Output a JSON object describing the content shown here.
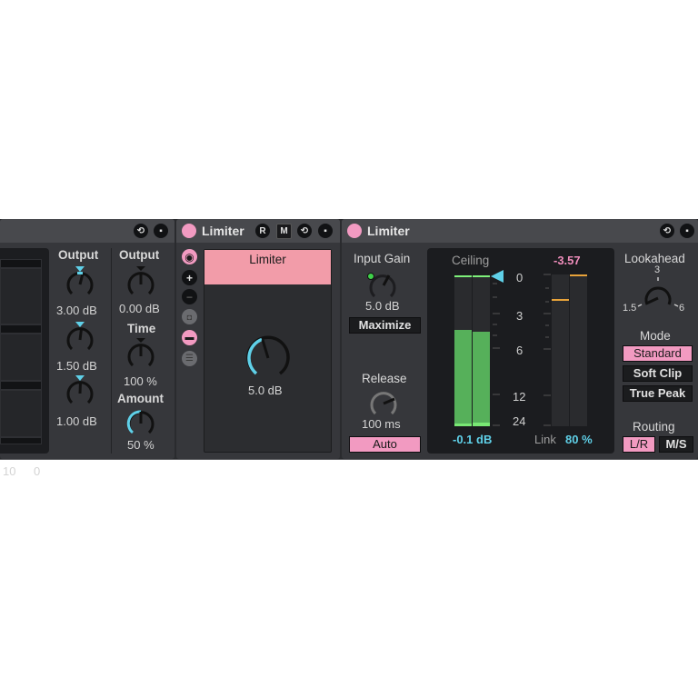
{
  "device1": {
    "output_label": "Output",
    "band_outputs": [
      "3.00 dB",
      "1.50 dB",
      "1.00 dB"
    ],
    "output2_label": "Output",
    "output2_value": "0.00 dB",
    "time_label": "Time",
    "time_value": "100 %",
    "amount_label": "Amount",
    "amount_value": "50 %",
    "scale_labels": [
      "10",
      "0"
    ],
    "icons": [
      "hot-swap-icon",
      "save-icon"
    ]
  },
  "device2": {
    "title": "Limiter",
    "r_label": "R",
    "m_label": "M",
    "macro_name": "Limiter",
    "macro_value": "5.0 dB",
    "icons": [
      "hot-swap-icon",
      "save-icon"
    ]
  },
  "device3": {
    "title": "Limiter",
    "input_gain_label": "Input Gain",
    "input_gain_value": "5.0 dB",
    "maximize_label": "Maximize",
    "release_label": "Release",
    "release_value": "100 ms",
    "auto_label": "Auto",
    "ceiling_label": "Ceiling",
    "ceiling_value": "-0.1 dB",
    "meter_scale": [
      "0",
      "3",
      "6",
      "12",
      "24"
    ],
    "gr_peak": "-3.57",
    "link_label": "Link",
    "link_value": "80 %",
    "lookahead_label": "Lookahead",
    "lookahead_ticks": [
      "1.5",
      "3",
      "6"
    ],
    "mode_label": "Mode",
    "modes": [
      "Standard",
      "Soft Clip",
      "True Peak"
    ],
    "selected_mode": "Standard",
    "routing_label": "Routing",
    "routing_options": [
      "L/R",
      "M/S"
    ],
    "selected_routing": "L/R",
    "input_level_fraction": 0.64,
    "icons": [
      "hot-swap-icon",
      "save-icon"
    ]
  },
  "colors": {
    "accent_pink": "#f29ac1",
    "accent_cyan": "#5fd0e8",
    "meter_green": "#56b05a",
    "gr_orange": "#e8a33a",
    "value_pink": "#ef8dbb"
  }
}
